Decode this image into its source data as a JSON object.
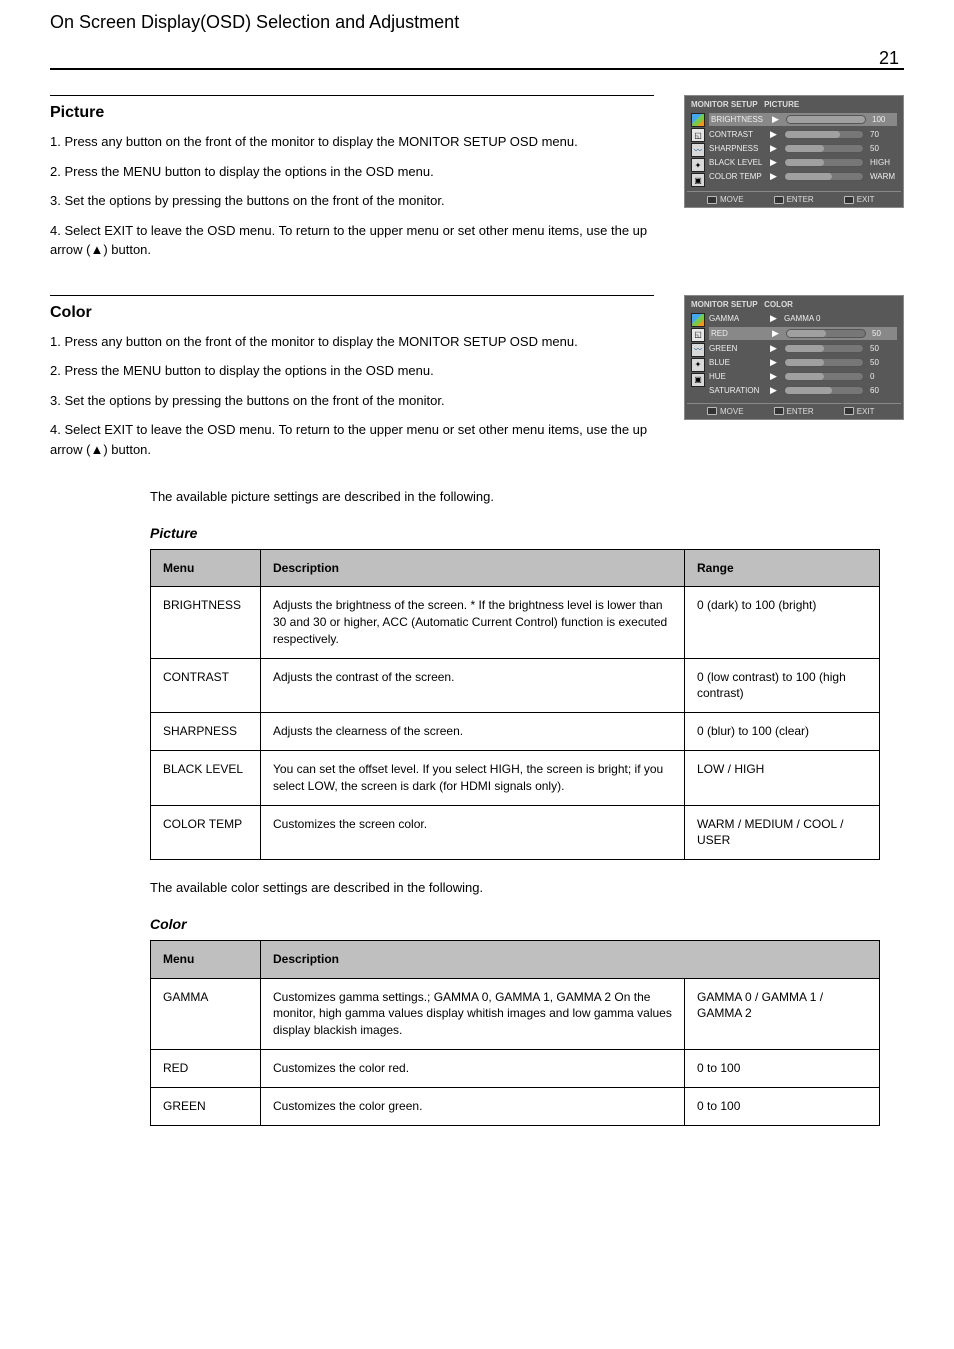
{
  "header": {
    "title": "On Screen Display(OSD) Selection and Adjustment",
    "page": "21"
  },
  "picture": {
    "title": "Picture",
    "body": [
      "1. Press any button on the front of the monitor to display the MONITOR SETUP OSD menu.",
      "2. Press the MENU button to display the options in the OSD menu.",
      "3. Set the options by pressing the buttons on the front of the monitor.",
      "4. Select EXIT to leave the OSD menu.\nTo return to the upper menu or set other menu items, use the up arrow (▲) button."
    ]
  },
  "color": {
    "title": "Color",
    "body": [
      "1. Press any button on the front of the monitor to display the MONITOR SETUP OSD menu.",
      "2. Press the MENU button to display the options in the OSD menu.",
      "3. Set the options by pressing the buttons on the front of the monitor.",
      "4. Select EXIT to leave the OSD menu.\nTo return to the upper menu or set other menu items, use the up arrow (▲) button."
    ]
  },
  "intro": "The available picture settings are described in the following.",
  "tableA": {
    "headers": [
      "Menu",
      "Description",
      "Range"
    ],
    "rows": [
      [
        "BRIGHTNESS",
        "Adjusts the brightness of the screen.\n* If the brightness level is lower than 30 and 30 or higher, ACC (Automatic Current Control) function is executed respectively.",
        "0 (dark) to 100 (bright)"
      ],
      [
        "CONTRAST",
        "Adjusts the contrast of the screen.",
        "0 (low contrast) to 100 (high contrast)"
      ],
      [
        "SHARPNESS",
        "Adjusts the clearness of the screen.",
        "0 (blur) to 100 (clear)"
      ],
      [
        "BLACK LEVEL",
        "You can set the offset level. If you select HIGH, the screen is bright; if you select LOW, the screen is dark (for HDMI signals only).",
        "LOW / HIGH"
      ],
      [
        "COLOR TEMP",
        "Customizes the screen color.",
        "WARM / MEDIUM / COOL / USER"
      ]
    ]
  },
  "intro2": "The available color settings are described in the following.",
  "tableB": {
    "headers": [
      "Menu",
      "Description"
    ],
    "rows": [
      [
        "GAMMA",
        "Customizes gamma settings.; GAMMA 0, GAMMA 1, GAMMA 2\nOn the monitor, high gamma values display whitish images and low gamma values display blackish images.",
        "GAMMA 0 / GAMMA 1 / GAMMA 2"
      ],
      [
        "RED",
        "Customizes the color red.",
        "0 to 100"
      ],
      [
        "GREEN",
        "Customizes the color green.",
        "0 to 100"
      ]
    ]
  },
  "osd1": {
    "title": "MONITOR SETUP",
    "section": "PICTURE",
    "rows": [
      {
        "label": "BRIGHTNESS",
        "type": "slider",
        "fill": 100,
        "value": "100"
      },
      {
        "label": "CONTRAST",
        "type": "slider",
        "fill": 70,
        "value": "70"
      },
      {
        "label": "SHARPNESS",
        "type": "slider",
        "fill": 50,
        "value": "50"
      },
      {
        "label": "BLACK LEVEL",
        "type": "slider",
        "fill": 50,
        "value": "HIGH"
      },
      {
        "label": "COLOR TEMP",
        "type": "slider",
        "fill": 60,
        "value": "WARM"
      }
    ],
    "foot": [
      {
        "icon": "arrows",
        "label": "MOVE"
      },
      {
        "icon": "enter",
        "label": "ENTER"
      },
      {
        "icon": "exit",
        "label": "EXIT"
      }
    ]
  },
  "osd2": {
    "title": "MONITOR SETUP",
    "section": "COLOR",
    "rows": [
      {
        "label": "GAMMA",
        "type": "arrow",
        "value": "GAMMA 0"
      },
      {
        "label": "RED",
        "type": "slider",
        "fill": 50,
        "value": "50"
      },
      {
        "label": "GREEN",
        "type": "slider",
        "fill": 50,
        "value": "50"
      },
      {
        "label": "BLUE",
        "type": "slider",
        "fill": 50,
        "value": "50"
      },
      {
        "label": "HUE",
        "type": "slider",
        "fill": 50,
        "value": "0"
      },
      {
        "label": "SATURATION",
        "type": "slider",
        "fill": 60,
        "value": "60"
      }
    ],
    "foot": [
      {
        "icon": "arrows",
        "label": "MOVE"
      },
      {
        "icon": "enter",
        "label": "ENTER"
      },
      {
        "icon": "exit",
        "label": "EXIT"
      }
    ]
  },
  "featurePicture": "Picture",
  "featureColor": "Color"
}
